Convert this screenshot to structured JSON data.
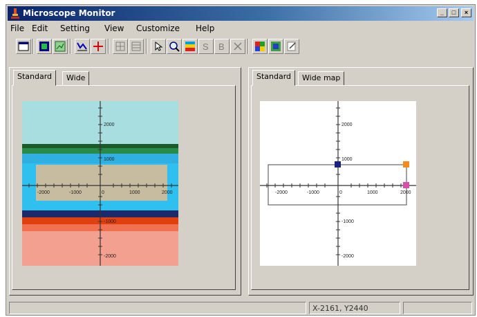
{
  "window": {
    "title": "Microscope Monitor",
    "controls": [
      "_",
      "□",
      "×"
    ]
  },
  "menu": [
    "File",
    "Edit",
    "Setting",
    "View",
    "Customize",
    "Help"
  ],
  "toolbar": {
    "tools": [
      "window-icon",
      "image-icon",
      "chart-icon",
      "graph-icon",
      "crosshair-icon",
      "grid-icon",
      "grid-alt-icon",
      "pointer-icon",
      "zoom-icon",
      "color-map-icon",
      "s-icon",
      "b-icon",
      "delete-icon",
      "layout-icon",
      "palette-icon",
      "edit-icon"
    ]
  },
  "left_panel": {
    "tabs": [
      "Standard",
      "Wide"
    ],
    "active_tab": "Standard",
    "axis": {
      "x_labels": [
        "-2000",
        "-1000",
        "0",
        "1000",
        "2000"
      ],
      "y_labels": [
        "2000",
        "1000",
        "-1000",
        "-2000"
      ]
    }
  },
  "right_panel": {
    "tabs": [
      "Standard",
      "Wide map"
    ],
    "active_tab": "Standard",
    "axis": {
      "x_labels": [
        "-2000",
        "-1000",
        "0",
        "1000",
        "2000"
      ],
      "y_labels": [
        "2000",
        "1000",
        "-1000",
        "-2000"
      ]
    },
    "marker_colors": {
      "blue": "#1a237e",
      "orange": "#f28c1f",
      "pink": "#d94fa8"
    }
  },
  "status": {
    "coords": "X-2161, Y2440"
  },
  "colors": {
    "title_start": "#0a246a",
    "face": "#d4d0c8"
  }
}
